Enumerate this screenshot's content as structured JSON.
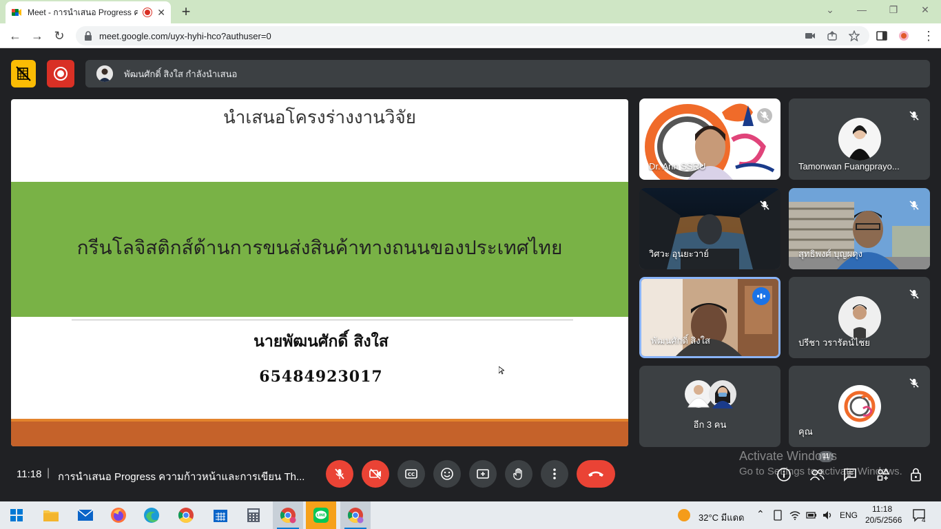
{
  "browser": {
    "tab_title": "Meet - การนำเสนอ Progress ควา",
    "new_tab": "+",
    "url": "meet.google.com/uyx-hyhi-hco?authuser=0"
  },
  "meet": {
    "presenting_text": "พัฒนศักดิ์ สิงใส กำลังนำเสนอ",
    "slide": {
      "title": "นำเสนอโครงร่างงานวิจัย",
      "band_text": "กรีนโลจิสติกส์ด้านการขนส่งสินค้าทางถนนของประเทศไทย",
      "presenter_name": "นายพัฒนศักดิ์  สิงใส",
      "student_id": "65484923017"
    },
    "participants": [
      {
        "name": "Dr. Ann SSRU",
        "muted": true
      },
      {
        "name": "Tamonwan Fuangprayo...",
        "muted": true
      },
      {
        "name": "วิศวะ อุนยะวาย์",
        "muted": true
      },
      {
        "name": "สุทธิพงศ์ บุญผดุง",
        "muted": true
      },
      {
        "name": "พัฒนศักดิ์ สิงใส",
        "speaking": true
      },
      {
        "name": "ปรีชา วรารัตน์ไชย",
        "muted": true
      },
      {
        "name": "อีก 3 คน"
      },
      {
        "name": "คุณ",
        "muted": true
      }
    ],
    "bottom": {
      "time": "11:18",
      "separator": "|",
      "meeting_title": "การนำเสนอ Progress ความก้าวหน้าและการเขียน Th...",
      "people_count": "11"
    },
    "watermark": {
      "line1": "Activate Windows",
      "line2": "Go to Settings to activate Windows."
    }
  },
  "taskbar": {
    "weather": "32°C  มีแดด",
    "lang": "ENG",
    "clock_time": "11:18",
    "clock_date": "20/5/2566",
    "notifications": "4"
  },
  "colors": {
    "meet_bg": "#202124",
    "slide_green": "#79b246",
    "slide_orange": "#c5622a",
    "end_call_red": "#ea4335",
    "tab_bar": "#cfe6c5"
  }
}
